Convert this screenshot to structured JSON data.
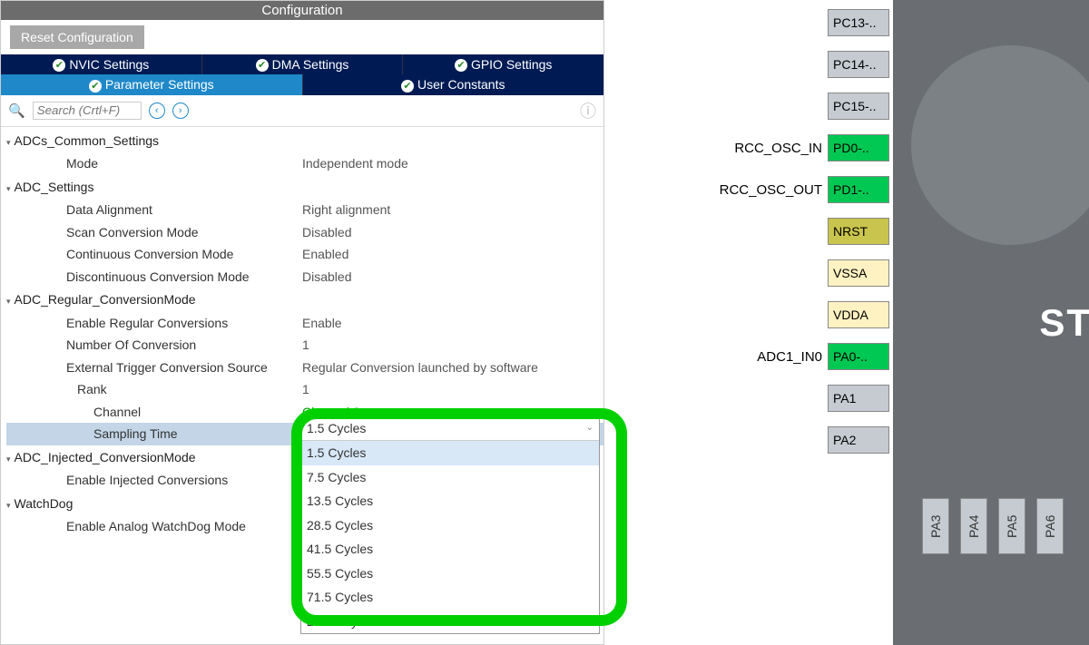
{
  "title": "Configuration",
  "reset_btn": "Reset Configuration",
  "tabs_top": [
    {
      "label": "NVIC Settings"
    },
    {
      "label": "DMA Settings"
    },
    {
      "label": "GPIO Settings"
    }
  ],
  "tabs_bottom": [
    {
      "label": "Parameter Settings",
      "active": true
    },
    {
      "label": "User Constants"
    }
  ],
  "search_placeholder": "Search (Crtl+F)",
  "groups": {
    "g0": {
      "header": "ADCs_Common_Settings",
      "rows": [
        {
          "lbl": "Mode",
          "val": "Independent mode"
        }
      ]
    },
    "g1": {
      "header": "ADC_Settings",
      "rows": [
        {
          "lbl": "Data Alignment",
          "val": "Right alignment"
        },
        {
          "lbl": "Scan Conversion Mode",
          "val": "Disabled"
        },
        {
          "lbl": "Continuous Conversion Mode",
          "val": "Enabled"
        },
        {
          "lbl": "Discontinuous Conversion Mode",
          "val": "Disabled"
        }
      ]
    },
    "g2": {
      "header": "ADC_Regular_ConversionMode",
      "rows": [
        {
          "lbl": "Enable Regular Conversions",
          "val": "Enable"
        },
        {
          "lbl": "Number Of Conversion",
          "val": "1"
        },
        {
          "lbl": "External Trigger Conversion Source",
          "val": "Regular Conversion launched by software"
        }
      ],
      "rank": {
        "lbl": "Rank",
        "val": "1"
      },
      "channel": {
        "lbl": "Channel",
        "val": "Channel 0"
      },
      "sampling": {
        "lbl": "Sampling Time",
        "val": "1.5 Cycles"
      }
    },
    "g3": {
      "header": "ADC_Injected_ConversionMode",
      "rows": [
        {
          "lbl": "Enable Injected Conversions",
          "val": ""
        }
      ]
    },
    "g4": {
      "header": "WatchDog",
      "rows": [
        {
          "lbl": "Enable Analog WatchDog Mode",
          "val": ""
        }
      ]
    }
  },
  "dropdown": {
    "selected": "1.5 Cycles",
    "options": [
      "1.5 Cycles",
      "7.5 Cycles",
      "13.5 Cycles",
      "28.5 Cycles",
      "41.5 Cycles",
      "55.5 Cycles",
      "71.5 Cycles",
      "239.5 Cycles"
    ]
  },
  "pins_left": [
    {
      "net": "",
      "label": "PC13-..",
      "cls": "default"
    },
    {
      "net": "",
      "label": "PC14-..",
      "cls": "default"
    },
    {
      "net": "",
      "label": "PC15-..",
      "cls": "default"
    },
    {
      "net": "RCC_OSC_IN",
      "label": "PD0-..",
      "cls": "green"
    },
    {
      "net": "RCC_OSC_OUT",
      "label": "PD1-..",
      "cls": "green"
    },
    {
      "net": "",
      "label": "NRST",
      "cls": "yellow"
    },
    {
      "net": "",
      "label": "VSSA",
      "cls": "cream"
    },
    {
      "net": "",
      "label": "VDDA",
      "cls": "cream"
    },
    {
      "net": "ADC1_IN0",
      "label": "PA0-..",
      "cls": "green"
    },
    {
      "net": "",
      "label": "PA1",
      "cls": "default"
    },
    {
      "net": "",
      "label": "PA2",
      "cls": "default"
    }
  ],
  "pins_bottom": [
    {
      "label": "PA3"
    },
    {
      "label": "PA4"
    },
    {
      "label": "PA5"
    },
    {
      "label": "PA6"
    }
  ],
  "chip_label": "STM"
}
